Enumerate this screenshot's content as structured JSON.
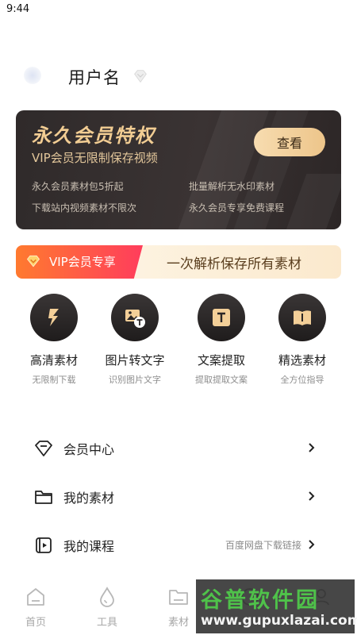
{
  "status_bar": {
    "time": "9:44"
  },
  "profile": {
    "username": "用户名",
    "avatar_icon": "avatar-placeholder-icon",
    "badge_icon": "diamond-icon"
  },
  "vip_card": {
    "title": "永久会员特权",
    "subtitle": "VIP会员无限制保存视频",
    "button_label": "查看",
    "features": [
      "永久会员素材包5折起",
      "批量解析无水印素材",
      "下载站内视频素材不限次",
      "永久会员专享免费课程"
    ],
    "colors": {
      "background": "#2f2a2a",
      "gold": "#f2cd93"
    }
  },
  "banner": {
    "left_label": "VIP会员专享",
    "right_label": "一次解析保存所有素材",
    "left_icon": "vip-gem-icon"
  },
  "tools": [
    {
      "name": "高清素材",
      "desc": "无限制下载",
      "icon": "lightning-icon"
    },
    {
      "name": "图片转文字",
      "desc": "识别图片文字",
      "icon": "image-to-text-icon"
    },
    {
      "name": "文案提取",
      "desc": "提取提取文案",
      "icon": "text-extract-icon"
    },
    {
      "name": "精选素材",
      "desc": "全方位指导",
      "icon": "book-icon"
    }
  ],
  "menu": [
    {
      "label": "会员中心",
      "hint": "",
      "icon": "diamond-outline-icon"
    },
    {
      "label": "我的素材",
      "hint": "",
      "icon": "folder-icon"
    },
    {
      "label": "我的课程",
      "hint": "百度网盘下载链接",
      "icon": "video-course-icon"
    }
  ],
  "tabbar": [
    {
      "label": "首页",
      "icon": "home-icon"
    },
    {
      "label": "工具",
      "icon": "drop-icon"
    },
    {
      "label": "素材",
      "icon": "folder-tab-icon"
    },
    {
      "label": "",
      "icon": "tab-icon-4"
    },
    {
      "label": "",
      "icon": "tab-icon-5"
    }
  ],
  "watermark": {
    "main": "谷普软件园",
    "url": "www.gupuxlazai.com"
  }
}
